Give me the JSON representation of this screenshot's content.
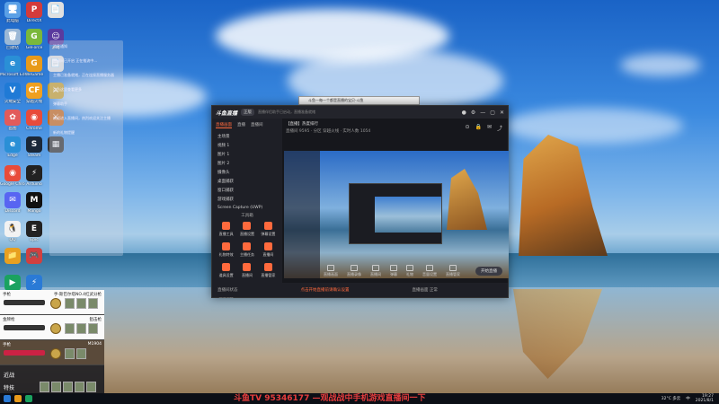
{
  "desktop": {
    "icons": [
      {
        "label": "此电脑",
        "color": "#5aa0e6",
        "glyph": "🖥"
      },
      {
        "label": "DirectX",
        "color": "#d33b3b",
        "glyph": "P"
      },
      {
        "label": "",
        "color": "#e0e0e0",
        "glyph": "📄"
      },
      {
        "label": "回收站",
        "color": "#9bb8d6",
        "glyph": "🗑"
      },
      {
        "label": "GeForce",
        "color": "#7ab83b",
        "glyph": "G"
      },
      {
        "label": "游戏",
        "color": "#5a3a9e",
        "glyph": "☺"
      },
      {
        "label": "Microsoft Edge",
        "color": "#2a8fd6",
        "glyph": "e"
      },
      {
        "label": "WeGame",
        "color": "#e89a1a",
        "glyph": "G"
      },
      {
        "label": "",
        "color": "#e0e0e0",
        "glyph": "📄"
      },
      {
        "label": "火绒安全",
        "color": "#1f7ad6",
        "glyph": "V"
      },
      {
        "label": "穿越火线",
        "color": "#f0a020",
        "glyph": "CF"
      },
      {
        "label": "",
        "color": "#c8a030",
        "glyph": "⚔"
      },
      {
        "label": "画图",
        "color": "#e25b5b",
        "glyph": "✿"
      },
      {
        "label": "Chrome",
        "color": "#e84b3a",
        "glyph": "◉"
      },
      {
        "label": "",
        "color": "#c86a20",
        "glyph": "⚔"
      },
      {
        "label": "Edge",
        "color": "#2a8fd6",
        "glyph": "e"
      },
      {
        "label": "Steam",
        "color": "#1b2838",
        "glyph": "S"
      },
      {
        "label": "",
        "color": "#333",
        "glyph": "▦"
      },
      {
        "label": "Google Chrome",
        "color": "#e84b3a",
        "glyph": "◉"
      },
      {
        "label": "Arduino",
        "color": "#222",
        "glyph": "⚡"
      },
      {
        "label": "Discord",
        "color": "#5865f2",
        "glyph": "✉"
      },
      {
        "label": "Mango",
        "color": "#111",
        "glyph": "M"
      },
      {
        "label": "QQ",
        "color": "#f2f2f2",
        "glyph": "🐧"
      },
      {
        "label": "Epic",
        "color": "#222",
        "glyph": "E"
      },
      {
        "label": "",
        "color": "#e8a020",
        "glyph": "📁"
      },
      {
        "label": "",
        "color": "#d04040",
        "glyph": "🎮"
      },
      {
        "label": "Play",
        "color": "#1aa260",
        "glyph": "▶"
      },
      {
        "label": "",
        "color": "#2a7ad6",
        "glyph": "⚡"
      }
    ],
    "notification_lines": [
      "消息通知",
      "直播间已开启 正在推流中...",
      "主播已准备就绪，正在连接直播服务器",
      "点击这里查看更多",
      "弹幕助手",
      "欢迎进入直播间，热烈欢迎关注主播",
      "新的礼物提醒"
    ]
  },
  "weapons_panel": {
    "rows": [
      {
        "name": "手枪",
        "rank": "手-斯巴尔塔NO.4红武分枪",
        "dark": false
      },
      {
        "name": "金牌枪",
        "rank": "狙击枪",
        "dark": false
      },
      {
        "name": "手枪",
        "rank": "M1904",
        "dark": true
      }
    ],
    "footer": [
      "近战",
      "特技"
    ]
  },
  "stream_app": {
    "logo": "斗鱼直播",
    "version_pill": "正版",
    "title_hint": "直播伴侣助手已启动，直播准备就绪",
    "left_tabs": [
      {
        "label": "直播画面",
        "active": true
      },
      {
        "label": "直播",
        "active": false
      },
      {
        "label": "直播间",
        "active": false
      }
    ],
    "sources": [
      "主场景",
      "视频 1",
      "图片 1",
      "图片 2",
      "摄像头",
      "桌面捕获",
      "窗口捕获",
      "游戏捕获",
      "Screen Capture (UWP)"
    ],
    "tools_title": "工具箱",
    "tools": [
      "直播工具",
      "直播设置",
      "弹幕设置",
      "礼物特效",
      "主播任务",
      "直播间",
      "道具设置",
      "直播间",
      "直播管家",
      "直播设置"
    ],
    "room_title": "【直播】热度排行",
    "room_info": "直播间 9595 · 分区 穿越火线 · 实时人数 1054",
    "bottom_buttons": [
      "直播画面",
      "直播录像",
      "直播间",
      "弹幕",
      "礼物",
      "音量设置",
      "直播管家"
    ],
    "start_button": "开始直播",
    "footer_left": "直播间状态",
    "footer_warn": "点击开始直播前请确认设置",
    "footer_right": "直播画面 正常"
  },
  "browser_bar": "斗鱼—每一个都是直播的宝贝-斗鱼",
  "taskbar": {
    "ticker": "斗鱼TV 95346177 —观战战中手机游戏直播间一下",
    "weather": "32°C 多云",
    "time": "19:27",
    "date": "2021/8/1",
    "tray_lang": "中"
  },
  "colors": {
    "accent": "#ff6a3d",
    "ticker": "#e53d3d",
    "window_bg": "#1b1c22"
  }
}
